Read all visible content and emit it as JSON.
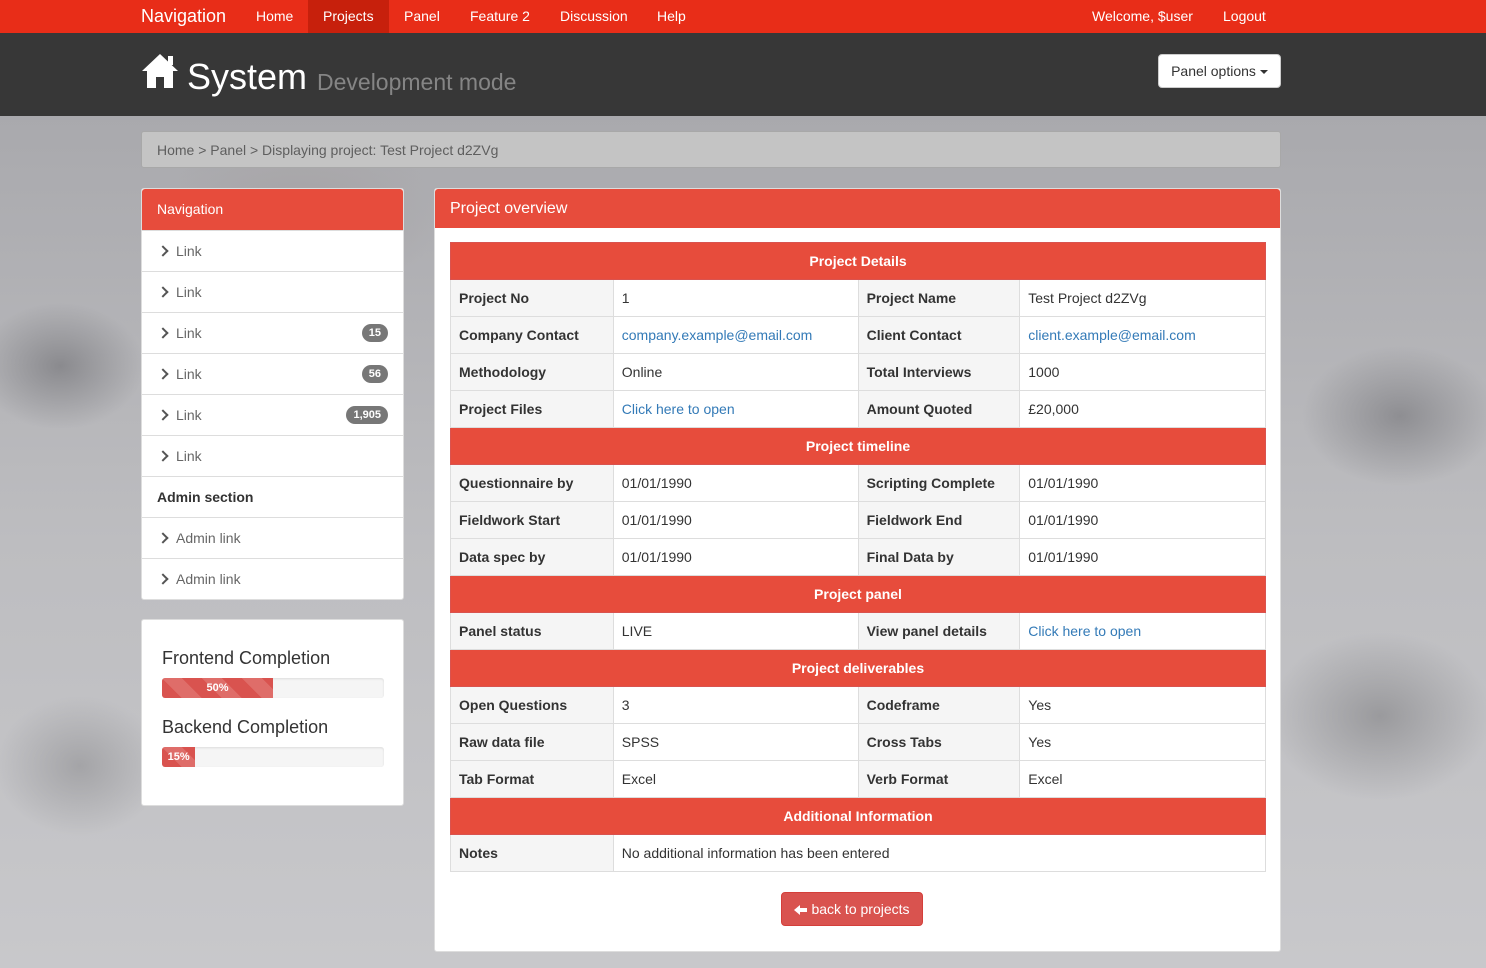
{
  "topnav": {
    "brand": "Navigation",
    "items": [
      "Home",
      "Projects",
      "Panel",
      "Feature 2",
      "Discussion",
      "Help"
    ],
    "active": "Projects",
    "welcome": "Welcome, $user",
    "logout": "Logout"
  },
  "header": {
    "title": "System",
    "subtitle": "Development mode",
    "panel_options": "Panel options"
  },
  "breadcrumb": "Home > Panel > Displaying project: Test Project d2ZVg",
  "sidebar": {
    "heading": "Navigation",
    "links": [
      {
        "label": "Link",
        "badge": ""
      },
      {
        "label": "Link",
        "badge": ""
      },
      {
        "label": "Link",
        "badge": "15"
      },
      {
        "label": "Link",
        "badge": "56"
      },
      {
        "label": "Link",
        "badge": "1,905"
      },
      {
        "label": "Link",
        "badge": ""
      }
    ],
    "admin_heading": "Admin section",
    "admin_links": [
      "Admin link",
      "Admin link"
    ]
  },
  "progress": {
    "frontend": {
      "title": "Frontend Completion",
      "label": "50%",
      "value": 50
    },
    "backend": {
      "title": "Backend Completion",
      "label": "15%",
      "value": 15
    }
  },
  "overview": {
    "heading": "Project overview",
    "sections": {
      "details": "Project Details",
      "timeline": "Project timeline",
      "panel": "Project panel",
      "deliverables": "Project deliverables",
      "additional": "Additional Information"
    },
    "details": {
      "project_no_label": "Project No",
      "project_no": "1",
      "project_name_label": "Project Name",
      "project_name": "Test Project d2ZVg",
      "company_contact_label": "Company Contact",
      "company_contact": "company.example@email.com",
      "client_contact_label": "Client Contact",
      "client_contact": "client.example@email.com",
      "methodology_label": "Methodology",
      "methodology": "Online",
      "total_interviews_label": "Total Interviews",
      "total_interviews": "1000",
      "project_files_label": "Project Files",
      "project_files": "Click here to open",
      "amount_quoted_label": "Amount Quoted",
      "amount_quoted": "£20,000"
    },
    "timeline": {
      "questionnaire_label": "Questionnaire by",
      "questionnaire": "01/01/1990",
      "scripting_label": "Scripting Complete",
      "scripting": "01/01/1990",
      "fieldwork_start_label": "Fieldwork Start",
      "fieldwork_start": "01/01/1990",
      "fieldwork_end_label": "Fieldwork End",
      "fieldwork_end": "01/01/1990",
      "data_spec_label": "Data spec by",
      "data_spec": "01/01/1990",
      "final_data_label": "Final Data by",
      "final_data": "01/01/1990"
    },
    "panel": {
      "status_label": "Panel status",
      "status": "LIVE",
      "status_color": "#2ca34a",
      "view_label": "View panel details",
      "view": "Click here to open"
    },
    "deliverables": {
      "open_q_label": "Open Questions",
      "open_q": "3",
      "codeframe_label": "Codeframe",
      "codeframe": "Yes",
      "raw_label": "Raw data file",
      "raw": "SPSS",
      "cross_label": "Cross Tabs",
      "cross": "Yes",
      "tab_format_label": "Tab Format",
      "tab_format": "Excel",
      "verb_format_label": "Verb Format",
      "verb_format": "Excel"
    },
    "additional": {
      "notes_label": "Notes",
      "notes": "No additional information has been entered"
    },
    "back_button": "back to projects"
  },
  "colors": {
    "nav_red": "#e82d18",
    "panel_red": "#e74c3c",
    "header_dark": "#373737",
    "link_blue": "#337ab7"
  }
}
